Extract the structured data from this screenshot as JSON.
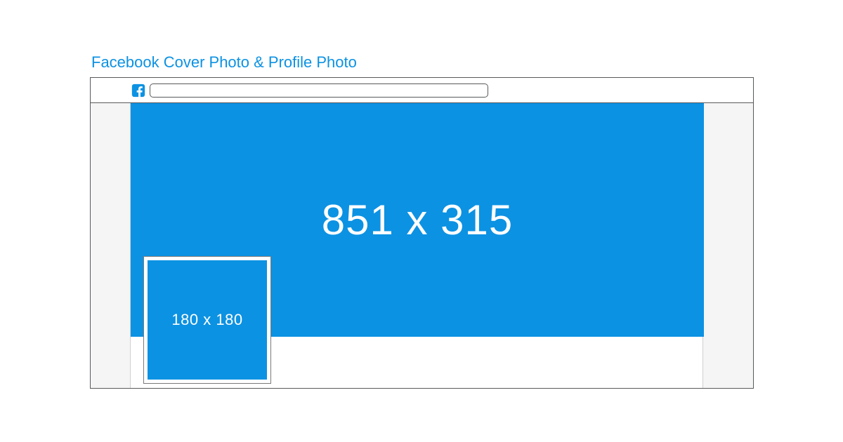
{
  "title": "Facebook Cover Photo & Profile Photo",
  "cover": {
    "dimensions_label": "851 x 315"
  },
  "profile": {
    "dimensions_label": "180 x 180"
  },
  "colors": {
    "brand_blue": "#0c92e3",
    "outline": "#58595b",
    "side_gray": "#f5f5f5"
  }
}
